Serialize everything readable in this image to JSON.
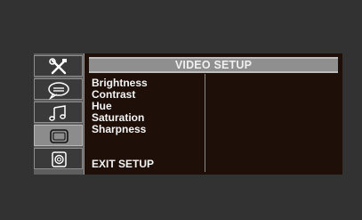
{
  "header": {
    "title": "VIDEO SETUP"
  },
  "menu": {
    "items": [
      {
        "label": "Brightness"
      },
      {
        "label": "Contrast"
      },
      {
        "label": "Hue"
      },
      {
        "label": "Saturation"
      },
      {
        "label": "Sharpness"
      }
    ],
    "exit_label": "EXIT  SETUP"
  },
  "tabs": [
    {
      "icon": "tools-icon",
      "active": false
    },
    {
      "icon": "speech-bubble-icon",
      "active": false
    },
    {
      "icon": "music-note-icon",
      "active": false
    },
    {
      "icon": "screen-icon",
      "active": true
    },
    {
      "icon": "speaker-icon",
      "active": false
    }
  ],
  "colors": {
    "background": "#323232",
    "content_bg": "#1e1008",
    "header_bar": "#8f8f8f",
    "active_tab": "#8c8c8c"
  }
}
